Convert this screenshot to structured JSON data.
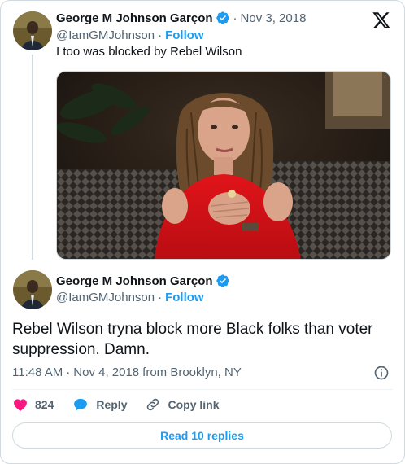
{
  "tweet_quoted": {
    "author_name": "George M Johnson Garçon",
    "handle": "@IamGMJohnson",
    "date": "Nov 3, 2018",
    "follow_label": "Follow",
    "text": "I too was blocked by Rebel Wilson"
  },
  "tweet_main": {
    "author_name": "George M Johnson Garçon",
    "handle": "@IamGMJohnson",
    "follow_label": "Follow",
    "text": "Rebel Wilson tryna block more Black folks than voter suppression. Damn.",
    "time": "11:48 AM",
    "date": "Nov 4, 2018",
    "location": "from Brooklyn, NY"
  },
  "actions": {
    "like_count": "824",
    "reply_label": "Reply",
    "copy_link_label": "Copy link"
  },
  "read_replies_label": "Read 10 replies",
  "separators": {
    "dot": "·"
  },
  "icons": {
    "verified": "verified-badge-icon",
    "platform": "x-logo-icon",
    "info": "info-icon",
    "like": "heart-icon",
    "reply": "reply-bubble-icon",
    "copy_link": "link-icon"
  },
  "colors": {
    "accent": "#1d9bf0",
    "like": "#f91880",
    "text": "#0f1419",
    "muted": "#536471",
    "border": "#cfd9de"
  }
}
